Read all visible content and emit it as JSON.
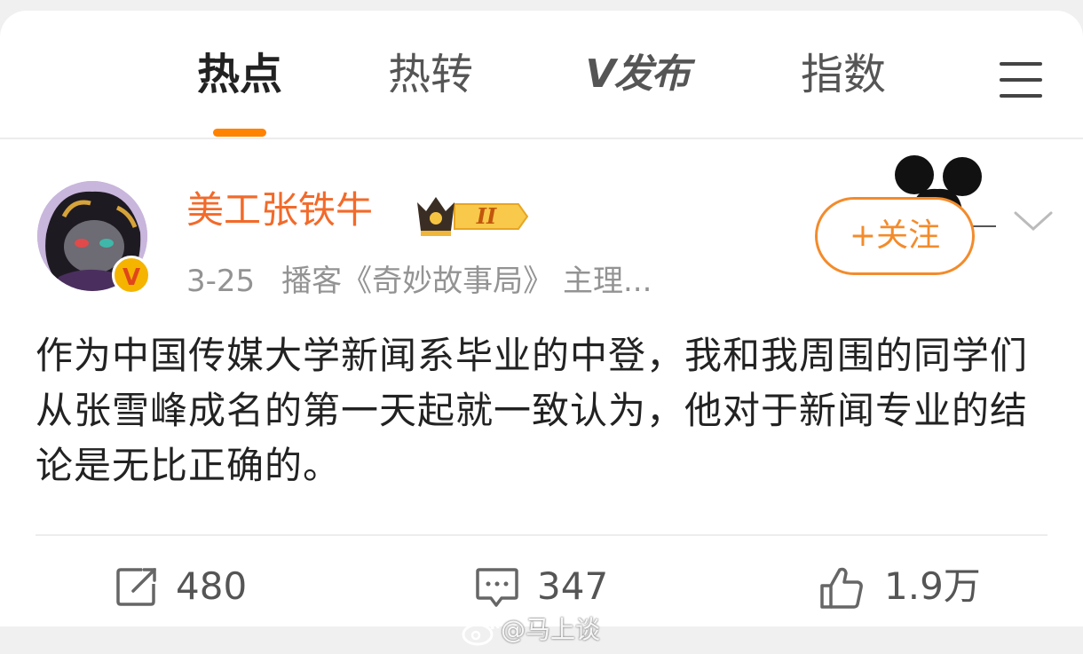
{
  "tabs": [
    {
      "label": "热点",
      "active": true
    },
    {
      "label": "热转",
      "active": false
    },
    {
      "label": "V发布",
      "active": false
    },
    {
      "label": "指数",
      "active": false
    }
  ],
  "post": {
    "username": "美工张铁牛",
    "vip_level": "II",
    "verify_mark": "V",
    "time": "3-25",
    "source": "播客《奇妙故事局》 主理...",
    "follow_label": "+关注",
    "text": "作为中国传媒大学新闻系毕业的中登，我和我周围的同学们从张雪峰成名的第一天起就一致认为，他对于新闻专业的结论是无比正确的。"
  },
  "actions": {
    "repost_count": "480",
    "comment_count": "347",
    "like_count": "1.9万"
  },
  "watermark": "@马上谈",
  "colors": {
    "accent": "#ff8200",
    "username": "#f26a2a",
    "follow": "#f38b2b",
    "meta": "#939393"
  },
  "icons": [
    "menu-icon",
    "crown-badge-icon",
    "verified-icon",
    "chevron-down-icon",
    "repost-icon",
    "comment-icon",
    "like-icon",
    "weibo-logo-icon"
  ]
}
